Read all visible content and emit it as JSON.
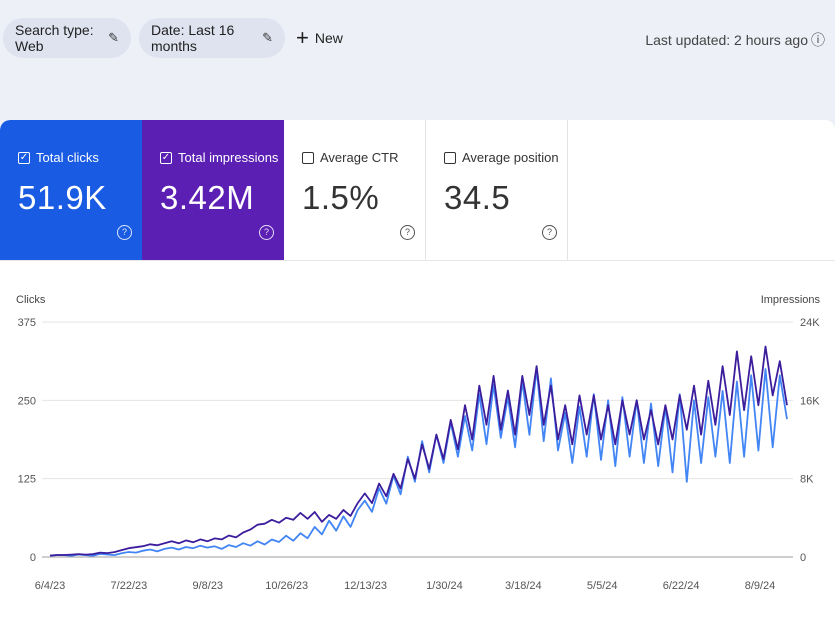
{
  "filters": {
    "search_type": "Search type: Web",
    "date": "Date: Last 16 months",
    "new_label": "New"
  },
  "last_updated": "Last updated: 2 hours ago",
  "metrics": [
    {
      "label": "Total clicks",
      "value": "51.9K",
      "selected": true,
      "color": "#1a5be3"
    },
    {
      "label": "Total impressions",
      "value": "3.42M",
      "selected": true,
      "color": "#5b1fb3"
    },
    {
      "label": "Average CTR",
      "value": "1.5%",
      "selected": false
    },
    {
      "label": "Average position",
      "value": "34.5",
      "selected": false
    }
  ],
  "chart_data": {
    "type": "line",
    "ylabel_left": "Clicks",
    "ylabel_right": "Impressions",
    "left_ticks": [
      "375",
      "250",
      "125",
      "0"
    ],
    "right_ticks": [
      "24K",
      "16K",
      "8K",
      "0"
    ],
    "x_ticks": [
      "6/4/23",
      "7/22/23",
      "9/8/23",
      "10/26/23",
      "12/13/23",
      "1/30/24",
      "3/18/24",
      "5/5/24",
      "6/22/24",
      "8/9/24"
    ],
    "ylim_left": [
      0,
      375
    ],
    "ylim_right": [
      0,
      24000
    ],
    "series": [
      {
        "name": "Clicks",
        "axis": "left",
        "color": "#4285f4",
        "values": [
          2,
          3,
          3,
          2,
          4,
          3,
          2,
          5,
          4,
          3,
          6,
          8,
          7,
          10,
          12,
          9,
          13,
          15,
          12,
          16,
          14,
          18,
          15,
          17,
          13,
          19,
          16,
          22,
          18,
          25,
          20,
          28,
          24,
          34,
          26,
          38,
          30,
          48,
          36,
          58,
          42,
          65,
          48,
          75,
          90,
          72,
          110,
          85,
          130,
          100,
          160,
          120,
          185,
          135,
          195,
          150,
          215,
          160,
          225,
          170,
          260,
          180,
          275,
          190,
          255,
          175,
          280,
          195,
          300,
          185,
          285,
          170,
          230,
          150,
          240,
          160,
          260,
          155,
          250,
          145,
          255,
          160,
          250,
          150,
          245,
          145,
          240,
          135,
          260,
          120,
          250,
          150,
          255,
          160,
          265,
          150,
          280,
          160,
          290,
          170,
          300,
          175,
          290,
          220
        ]
      },
      {
        "name": "Impressions",
        "axis": "right",
        "color": "#3c1d9c",
        "values": [
          150,
          200,
          200,
          250,
          300,
          250,
          300,
          450,
          400,
          500,
          700,
          900,
          1000,
          1100,
          1300,
          1200,
          1400,
          1600,
          1400,
          1700,
          1500,
          1800,
          1600,
          1900,
          1800,
          2200,
          2000,
          2500,
          2800,
          3300,
          3400,
          3800,
          3500,
          4000,
          3800,
          4500,
          3900,
          4600,
          3600,
          4300,
          3900,
          4800,
          4200,
          5500,
          6500,
          5500,
          7500,
          6200,
          8500,
          7000,
          10000,
          8000,
          11500,
          9000,
          12500,
          10000,
          14000,
          11000,
          15500,
          12000,
          17500,
          13500,
          18500,
          13000,
          17000,
          12500,
          18500,
          14500,
          19500,
          13500,
          17500,
          12000,
          15500,
          11500,
          16500,
          12500,
          16500,
          12000,
          15500,
          11500,
          16000,
          12500,
          16000,
          12000,
          15000,
          11500,
          15500,
          12000,
          16500,
          13000,
          17500,
          12500,
          18000,
          13500,
          19500,
          14500,
          21000,
          15000,
          20500,
          15500,
          21500,
          16500,
          20000,
          15500
        ]
      }
    ]
  }
}
